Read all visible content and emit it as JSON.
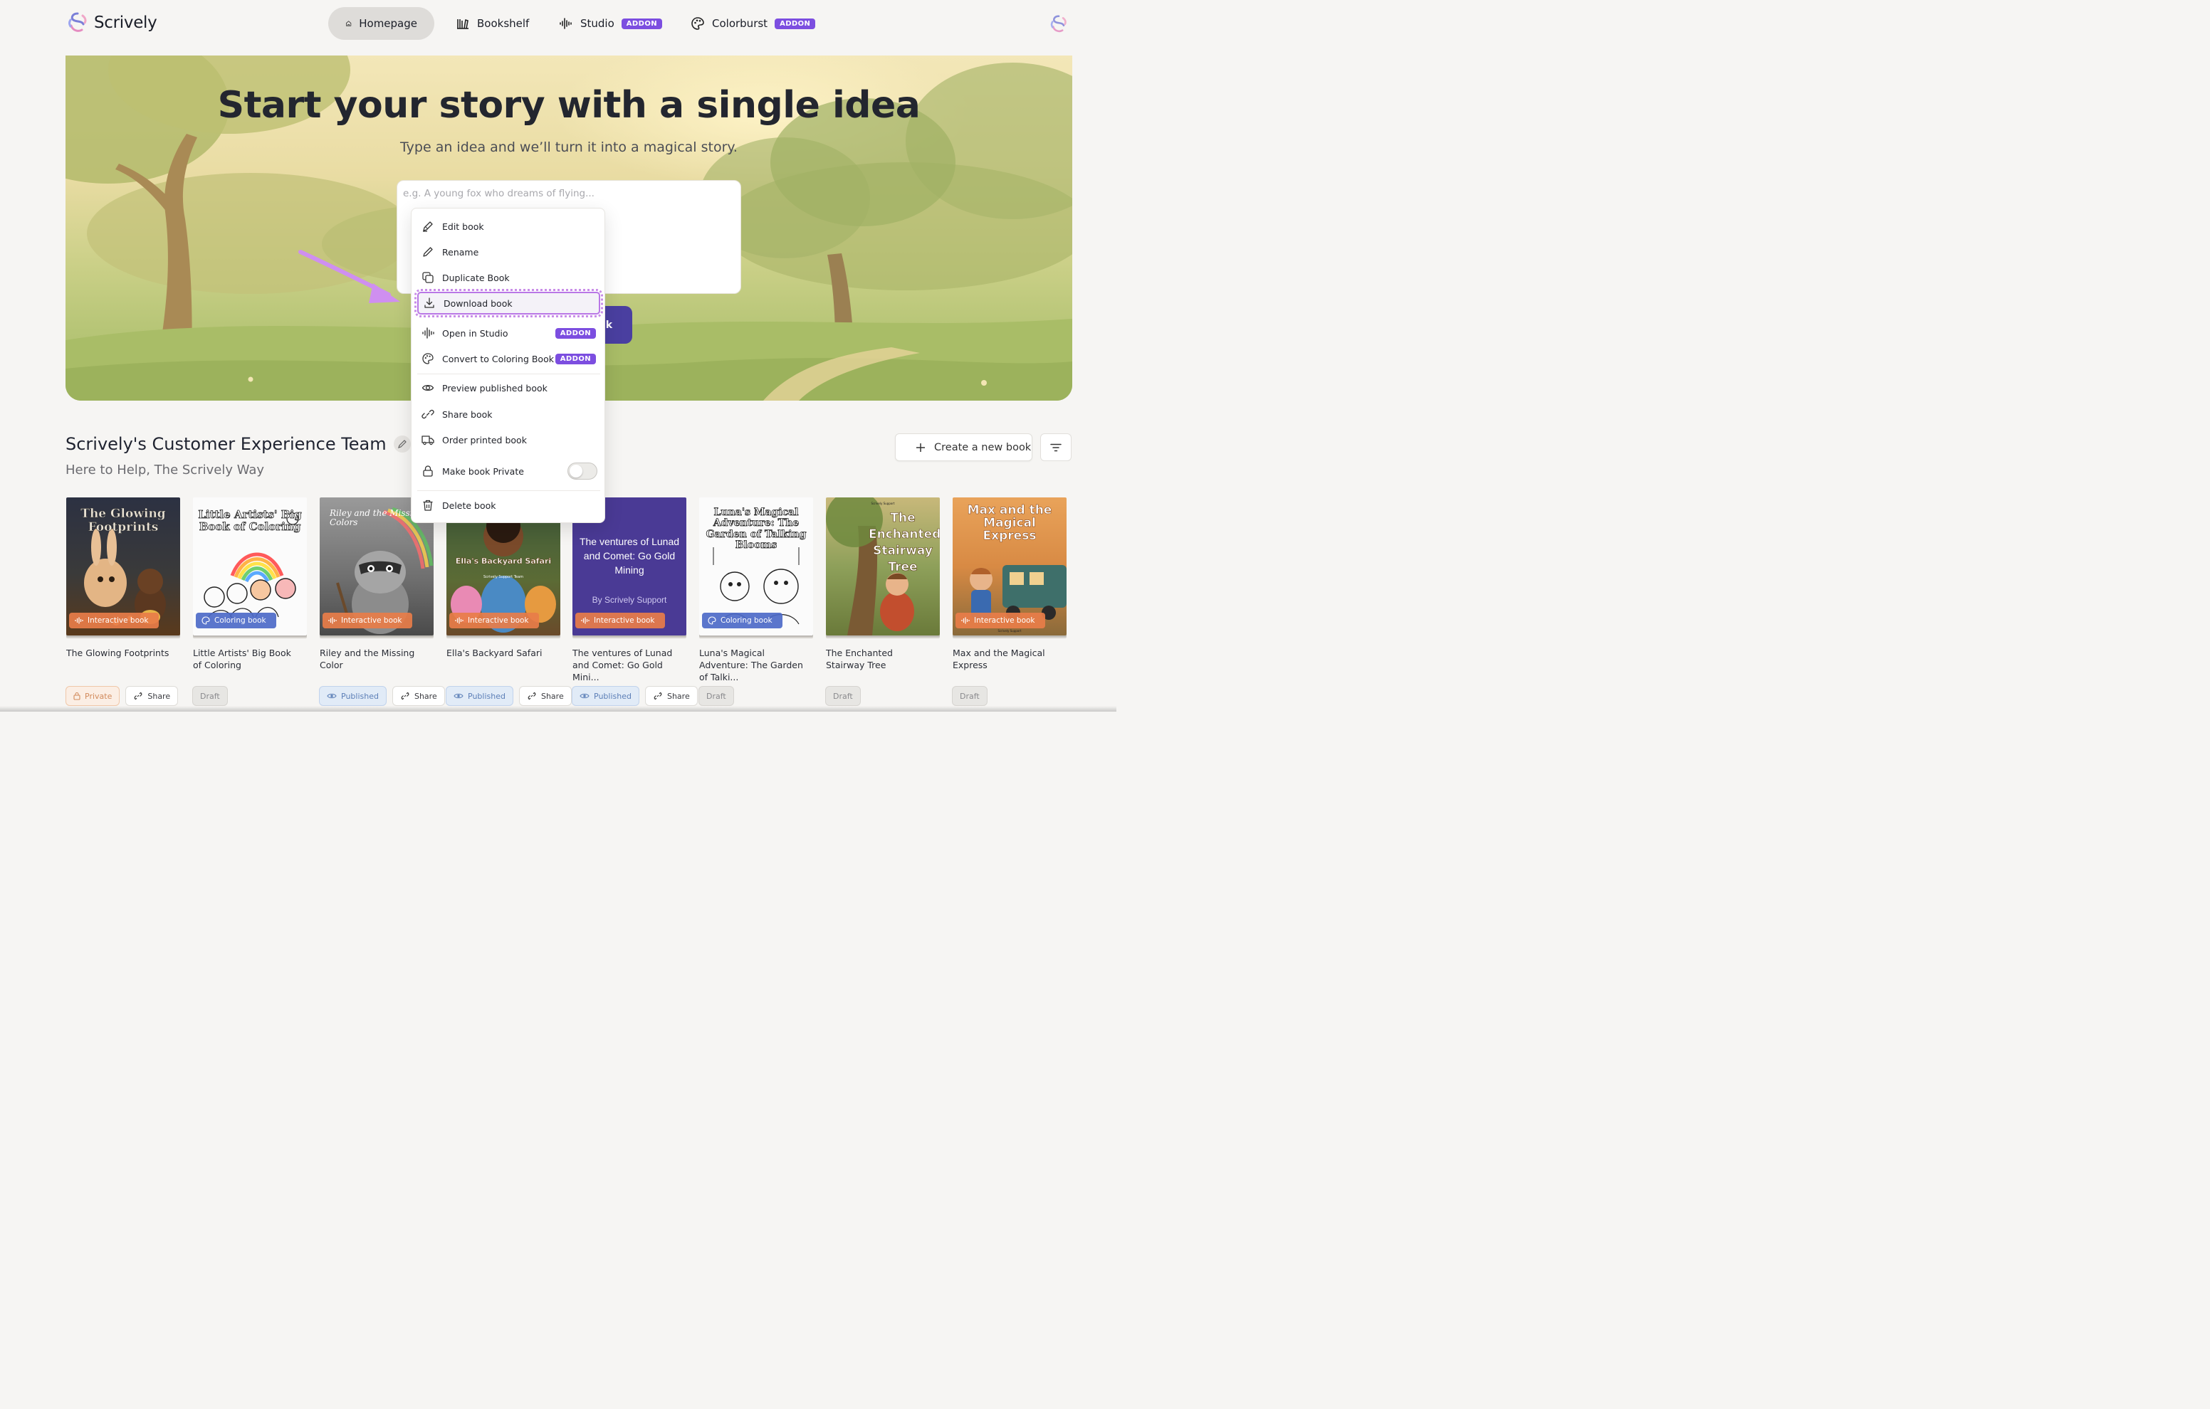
{
  "brand": {
    "name": "Scrively"
  },
  "nav": {
    "tabs": [
      {
        "label": "Homepage",
        "icon": "home-icon",
        "active": true
      },
      {
        "label": "Bookshelf",
        "icon": "bookshelf-icon"
      },
      {
        "label": "Studio",
        "icon": "audio-wave-icon",
        "badge": "ADDON"
      },
      {
        "label": "Colorburst",
        "icon": "palette-icon",
        "badge": "ADDON"
      }
    ]
  },
  "hero": {
    "title": "Start your story with a single idea",
    "subtitle": "Type an idea and we’ll turn it into a magical story.",
    "input_placeholder": "e.g. A young fox who dreams of flying...",
    "create_button_fragment": "k"
  },
  "context_menu": {
    "items": [
      {
        "label": "Edit book",
        "icon": "edit-book-icon"
      },
      {
        "label": "Rename",
        "icon": "pencil-icon"
      },
      {
        "label": "Duplicate Book",
        "icon": "duplicate-icon"
      },
      {
        "label": "Download book",
        "icon": "download-icon",
        "highlighted": true
      },
      {
        "label": "Open in Studio",
        "icon": "audio-wave-icon",
        "badge": "ADDON"
      },
      {
        "label": "Convert to Coloring Book",
        "icon": "palette-icon",
        "badge": "ADDON"
      },
      {
        "label": "Preview published book",
        "icon": "eye-icon"
      },
      {
        "label": "Share book",
        "icon": "link-icon"
      },
      {
        "label": "Order printed book",
        "icon": "truck-icon"
      },
      {
        "label": "Make book Private",
        "icon": "lock-icon",
        "toggle": false
      },
      {
        "label": "Delete book",
        "icon": "trash-icon"
      }
    ]
  },
  "team": {
    "title": "Scrively's Customer Experience Team",
    "subtitle": "Here to Help, The Scrively Way",
    "create_button": "Create a new book"
  },
  "books": [
    {
      "name": "The Glowing Footprints",
      "cover_title": "The Glowing Footprints",
      "type": "Interactive book",
      "status": "Private",
      "share": "Share"
    },
    {
      "name": "Little Artists' Big Book of Coloring",
      "cover_title": "Little Artists' Big Book of Coloring",
      "type": "Coloring book",
      "status": "Draft"
    },
    {
      "name": "Riley and the Missing Color",
      "cover_title": "Riley and the Missing Colors",
      "type": "Interactive book",
      "status": "Published",
      "share": "Share"
    },
    {
      "name": "Ella's Backyard Safari",
      "cover_title": "Ella's Backyard Safari",
      "cover_sub": "Scrively Support Team",
      "type": "Interactive book",
      "status": "Published",
      "share": "Share"
    },
    {
      "name": "The ventures of Lunad and Comet: Go Gold Mini...",
      "cover_title": "The ventures of Lunad and Comet: Go Gold Mining",
      "cover_sub": "By Scrively Support",
      "type": "Interactive book",
      "status": "Published",
      "share": "Share"
    },
    {
      "name": "Luna's Magical Adventure: The Garden of Talki...",
      "cover_title": "Luna's Magical Adventure: The Garden of Talking Blooms",
      "type": "Coloring book",
      "status": "Draft"
    },
    {
      "name": "The Enchanted Stairway Tree",
      "cover_title": "The Enchanted Stairway Tree",
      "cover_sub": "Scrively Support",
      "status": "Draft"
    },
    {
      "name": "Max and the Magical Express",
      "cover_title": "Max and the Magical Express",
      "cover_sub": "Scrively Support",
      "type": "Interactive book",
      "status": "Draft"
    }
  ],
  "colors": {
    "accent": "#7c4ee0",
    "primary_button": "#4a3fa0",
    "highlight": "#b977e6",
    "interactive_pill": "#e87d49",
    "coloring_pill": "#4d6ac8"
  }
}
